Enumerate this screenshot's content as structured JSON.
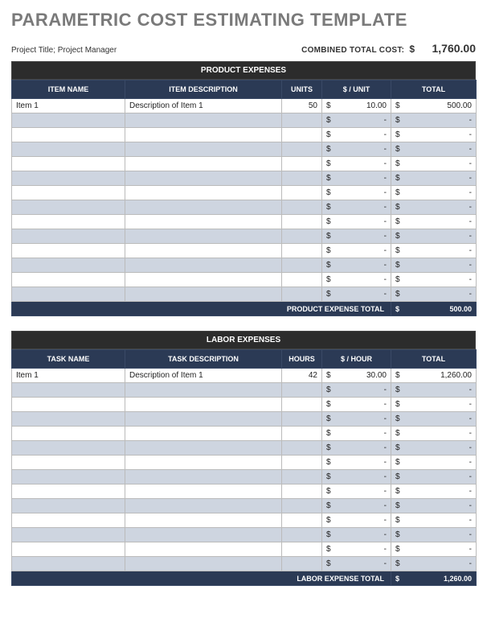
{
  "title": "PARAMETRIC COST ESTIMATING TEMPLATE",
  "meta": {
    "project_label": "Project Title; Project Manager",
    "combined_label": "COMBINED TOTAL COST:",
    "currency": "$",
    "combined_total": "1,760.00"
  },
  "product": {
    "section_title": "PRODUCT EXPENSES",
    "headers": {
      "name": "ITEM NAME",
      "desc": "ITEM DESCRIPTION",
      "units": "UNITS",
      "rate": "$ / UNIT",
      "total": "TOTAL"
    },
    "rows": [
      {
        "name": "Item 1",
        "desc": "Description of Item 1",
        "units": "50",
        "rate": "10.00",
        "total": "500.00"
      },
      {
        "name": "",
        "desc": "",
        "units": "",
        "rate": "-",
        "total": "-"
      },
      {
        "name": "",
        "desc": "",
        "units": "",
        "rate": "-",
        "total": "-"
      },
      {
        "name": "",
        "desc": "",
        "units": "",
        "rate": "-",
        "total": "-"
      },
      {
        "name": "",
        "desc": "",
        "units": "",
        "rate": "-",
        "total": "-"
      },
      {
        "name": "",
        "desc": "",
        "units": "",
        "rate": "-",
        "total": "-"
      },
      {
        "name": "",
        "desc": "",
        "units": "",
        "rate": "-",
        "total": "-"
      },
      {
        "name": "",
        "desc": "",
        "units": "",
        "rate": "-",
        "total": "-"
      },
      {
        "name": "",
        "desc": "",
        "units": "",
        "rate": "-",
        "total": "-"
      },
      {
        "name": "",
        "desc": "",
        "units": "",
        "rate": "-",
        "total": "-"
      },
      {
        "name": "",
        "desc": "",
        "units": "",
        "rate": "-",
        "total": "-"
      },
      {
        "name": "",
        "desc": "",
        "units": "",
        "rate": "-",
        "total": "-"
      },
      {
        "name": "",
        "desc": "",
        "units": "",
        "rate": "-",
        "total": "-"
      },
      {
        "name": "",
        "desc": "",
        "units": "",
        "rate": "-",
        "total": "-"
      }
    ],
    "footer_label": "PRODUCT EXPENSE TOTAL",
    "footer_total": "500.00"
  },
  "labor": {
    "section_title": "LABOR EXPENSES",
    "headers": {
      "name": "TASK NAME",
      "desc": "TASK DESCRIPTION",
      "units": "HOURS",
      "rate": "$ / HOUR",
      "total": "TOTAL"
    },
    "rows": [
      {
        "name": "Item 1",
        "desc": "Description of Item 1",
        "units": "42",
        "rate": "30.00",
        "total": "1,260.00"
      },
      {
        "name": "",
        "desc": "",
        "units": "",
        "rate": "-",
        "total": "-"
      },
      {
        "name": "",
        "desc": "",
        "units": "",
        "rate": "-",
        "total": "-"
      },
      {
        "name": "",
        "desc": "",
        "units": "",
        "rate": "-",
        "total": "-"
      },
      {
        "name": "",
        "desc": "",
        "units": "",
        "rate": "-",
        "total": "-"
      },
      {
        "name": "",
        "desc": "",
        "units": "",
        "rate": "-",
        "total": "-"
      },
      {
        "name": "",
        "desc": "",
        "units": "",
        "rate": "-",
        "total": "-"
      },
      {
        "name": "",
        "desc": "",
        "units": "",
        "rate": "-",
        "total": "-"
      },
      {
        "name": "",
        "desc": "",
        "units": "",
        "rate": "-",
        "total": "-"
      },
      {
        "name": "",
        "desc": "",
        "units": "",
        "rate": "-",
        "total": "-"
      },
      {
        "name": "",
        "desc": "",
        "units": "",
        "rate": "-",
        "total": "-"
      },
      {
        "name": "",
        "desc": "",
        "units": "",
        "rate": "-",
        "total": "-"
      },
      {
        "name": "",
        "desc": "",
        "units": "",
        "rate": "-",
        "total": "-"
      },
      {
        "name": "",
        "desc": "",
        "units": "",
        "rate": "-",
        "total": "-"
      }
    ],
    "footer_label": "LABOR EXPENSE TOTAL",
    "footer_total": "1,260.00"
  }
}
